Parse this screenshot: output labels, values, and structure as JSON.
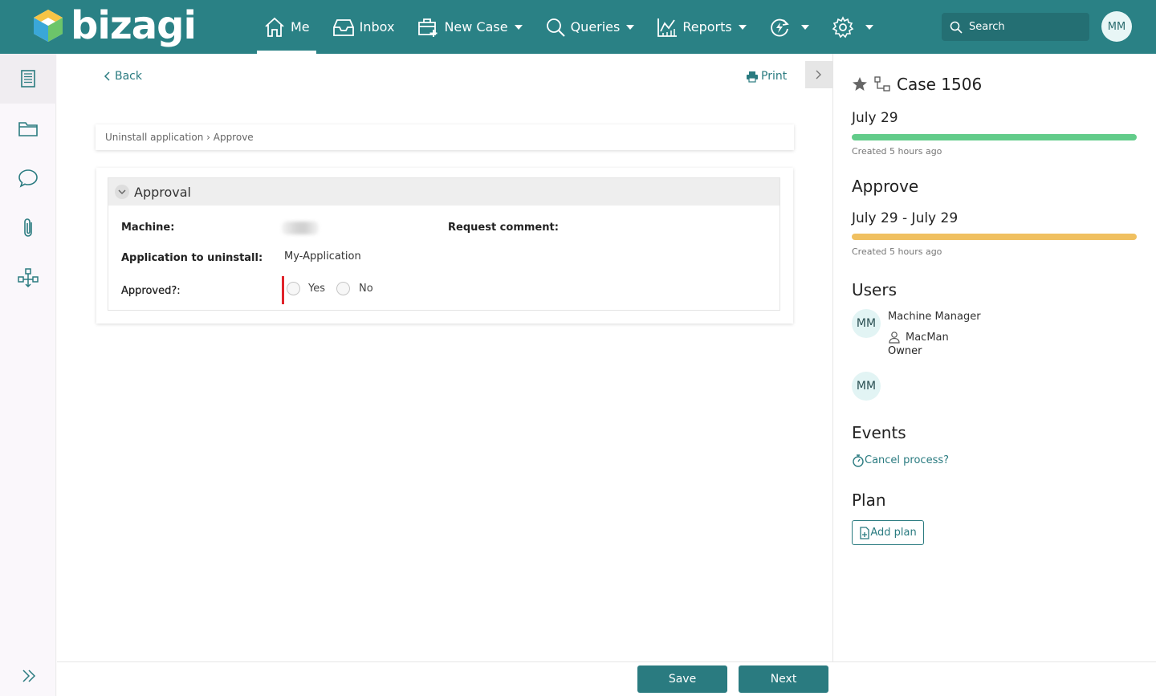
{
  "app": {
    "logo_text": "bizagi"
  },
  "nav": {
    "items": [
      {
        "label": "Me"
      },
      {
        "label": "Inbox"
      },
      {
        "label": "New Case"
      },
      {
        "label": "Queries"
      },
      {
        "label": "Reports"
      }
    ]
  },
  "search": {
    "placeholder": "Search"
  },
  "user": {
    "initials": "MM"
  },
  "toolbar": {
    "back_label": "Back",
    "print_label": "Print"
  },
  "breadcrumb": {
    "text": "Uninstall application › Approve"
  },
  "form": {
    "group_title": "Approval",
    "fields": {
      "machine_label": "Machine:",
      "request_comment_label": "Request comment:",
      "app_label": "Application to uninstall:",
      "app_value": "My-Application",
      "approved_label": "Approved?:",
      "yes_label": "Yes",
      "no_label": "No"
    }
  },
  "footer": {
    "save_label": "Save",
    "next_label": "Next"
  },
  "case_panel": {
    "case_title": "Case 1506",
    "case_date": "July 29",
    "case_created": "Created 5 hours ago",
    "case_progress": 1.0,
    "task_title": "Approve",
    "task_dates": "July 29 - July 29",
    "task_created": "Created 5 hours ago",
    "task_progress": 1.0,
    "users_heading": "Users",
    "user1_initials": "MM",
    "user1_name": "Machine Manager",
    "user1_login": "MacMan",
    "user1_role": "Owner",
    "user2_initials": "MM",
    "events_heading": "Events",
    "event_link": "Cancel process?",
    "plan_heading": "Plan",
    "add_plan_label": "Add plan",
    "colors": {
      "case_bar": "#62cc8a",
      "task_bar": "#f0c060"
    }
  }
}
